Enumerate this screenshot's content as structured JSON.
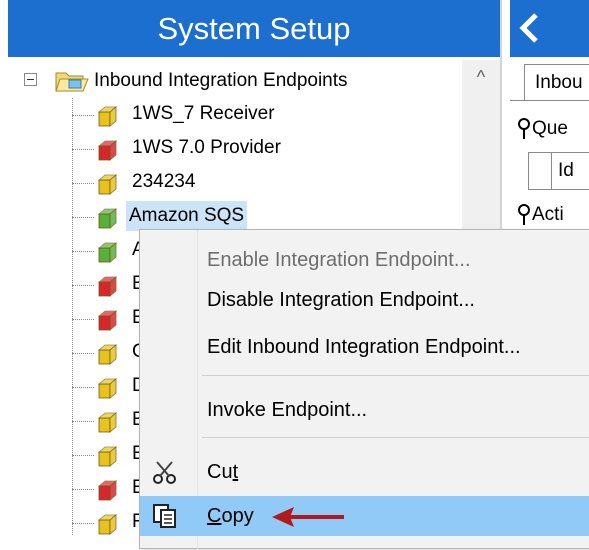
{
  "panel": {
    "title": "System Setup"
  },
  "tree": {
    "root_label": "Inbound Integration Endpoints",
    "scroll_up_glyph": "^",
    "items": [
      {
        "label": "1WS_7 Receiver",
        "icon": "endpoint-yellow-icon",
        "color": "#e8c21e"
      },
      {
        "label": "1WS 7.0 Provider",
        "icon": "endpoint-red-icon",
        "color": "#d8262f"
      },
      {
        "label": "234234",
        "icon": "endpoint-yellow-icon",
        "color": "#e8c21e"
      },
      {
        "label": "Amazon SQS",
        "icon": "endpoint-green-icon",
        "color": "#57b03a"
      },
      {
        "label": "A",
        "icon": "endpoint-green-icon",
        "color": "#57b03a"
      },
      {
        "label": "E",
        "icon": "endpoint-red-icon",
        "color": "#d8262f"
      },
      {
        "label": "E",
        "icon": "endpoint-red-icon",
        "color": "#d8262f"
      },
      {
        "label": "C",
        "icon": "endpoint-yellow-icon",
        "color": "#e8c21e"
      },
      {
        "label": "D",
        "icon": "endpoint-yellow-icon",
        "color": "#e8c21e"
      },
      {
        "label": "E",
        "icon": "endpoint-yellow-icon",
        "color": "#e8c21e"
      },
      {
        "label": "E",
        "icon": "endpoint-yellow-icon",
        "color": "#e8c21e"
      },
      {
        "label": "E",
        "icon": "endpoint-red-icon",
        "color": "#d8262f"
      },
      {
        "label": "F",
        "icon": "endpoint-yellow-icon",
        "color": "#e8c21e"
      }
    ]
  },
  "right": {
    "tab_label": "Inbou",
    "group1_label": "Que",
    "column_label": "Id",
    "group2_label": "Acti"
  },
  "context_menu": {
    "enable": "Enable Integration Endpoint...",
    "disable": "Disable Integration Endpoint...",
    "edit": "Edit Inbound Integration Endpoint...",
    "invoke": "Invoke Endpoint...",
    "cut_pre": "Cu",
    "cut_key": "t",
    "copy_key": "C",
    "copy_post": "opy"
  },
  "colors": {
    "title_bar": "#1c6fce",
    "selection": "#cce4f7",
    "menu_highlight": "#91c9f7",
    "arrow": "#b0191e"
  }
}
